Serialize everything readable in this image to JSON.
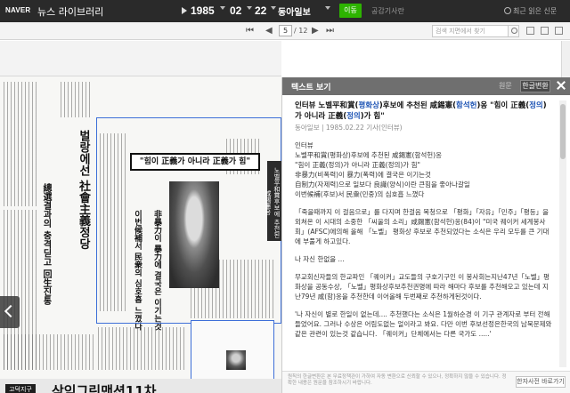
{
  "app": {
    "logo": "NAVER",
    "service": "뉴스 라이브러리"
  },
  "date": {
    "year": "1985",
    "month": "02",
    "day": "22",
    "newspaper": "동아일보",
    "go_label": "이동",
    "closed_day_label": "공감기사란",
    "recent_label": "최근 읽은 신문"
  },
  "pager": {
    "current": "5",
    "total": "/ 12",
    "search_placeholder": "검색 지면에서 찾기"
  },
  "newspaper_page": {
    "top_quote": "\"힘이 正義가 아니라 正義가 힘\"",
    "ad_label": "고덕지구",
    "ad_title": "삼익그린맨션11차"
  },
  "panel": {
    "title": "텍스트 보기",
    "tab_original": "원문",
    "tab_converted": "한글변환",
    "headline_parts": [
      {
        "t": "인터뷰 노벨平和賞(",
        "b": false
      },
      {
        "t": "평화상",
        "b": true
      },
      {
        "t": ")후보에 추천된 咸錫憲(",
        "b": false
      },
      {
        "t": "함석헌",
        "b": true
      },
      {
        "t": ")옹 \"힘이 正義(",
        "b": false
      },
      {
        "t": "정의",
        "b": true
      },
      {
        "t": ")가 아니라 正義(",
        "b": false
      },
      {
        "t": "정의",
        "b": true
      },
      {
        "t": ")가 힘\"",
        "b": false
      }
    ],
    "source": "동아일보 | 1985.02.22 기사(인터뷰)",
    "lines": [
      "인터뷰",
      "노벨平和賞(평화상)후보에 추천된 咸錫憲(함석헌)옹",
      "\"힘이 正義(정의)가 아니라 正義(정의)가 힘\"",
      "非暴力(비폭력)이 暴力(폭력)에 결국은 이기는것",
      "自制力(자제력)으로 일보다 良識(양식)이란 큰힘을 좋아나갈일",
      "이번候補(후보)서 民衆(민중)의 심호흡 느꼈다"
    ],
    "paragraphs": [
      "「죽을때까지 이 걸음으로」를 다지며 한걸음 목청으로 「평화」「자유」「민주」「평등」을 외쳐온 이 시대의 소중한 「씨울의 소리」咸錫憲(함석헌)옹(84)이 \"미국 퀘이커 세계봉사회」(AFSC)에의해 올해 「노벨」 평화상 후보로 추천되었다는 소식은 우리 모두를 큰 기대에 부풀게 하고있다.",
      "나 자신 한없을 ...",
      "무교회신자들의 한교파인 「퀘이커」교도들의 구호기구인 이 봉사회는지난47년「노벨」평화상을 공동수상, 「노벨」평화상후보추천권명에 따라 해마다 후보를 추천해오고 있는데 지난79년 咸(함)옹을 추천한데 이어올해 두번째로 추천하게된것이다.",
      "'나 자신이 별로 한일이 없는데.... 추천했다는 소식은 1월하순경 이 기구 관계자로 부터 전해들었어요. 그러나 수상은 어림도없는 얼이라고 봐요. 다만 이번 후보선정은한국의 남북문제와 같은 관련이 있는것 같습니다. 「퀘이커」단체에서는 다른 국가도 .....'"
    ],
    "footer_note": "원칙의 한글변환은 본 무료정책관이 가하여 자동 변환으로 신뢰할 수 있으나, 정확하지 않을 수 있습니다. 정확한 내용은 원문을 참조하시기 바랍니다.",
    "footer_button": "한자사전 바로가기"
  }
}
